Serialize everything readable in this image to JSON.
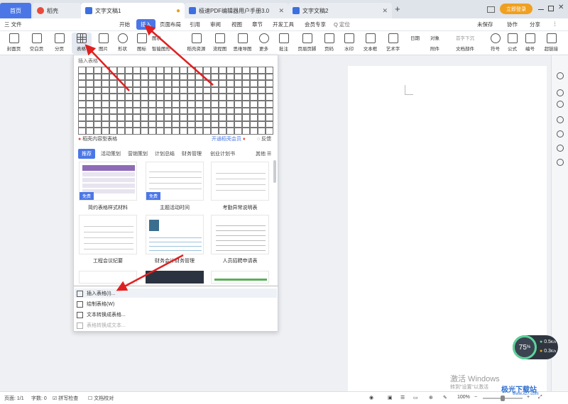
{
  "tabs": [
    {
      "label": "首页"
    },
    {
      "label": "稻壳"
    },
    {
      "label": "文字文稿1"
    },
    {
      "label": "极速PDF编辑器用户手册3.0"
    },
    {
      "label": "文字文稿2"
    }
  ],
  "titlebar": {
    "login": "立即登录"
  },
  "menubar": {
    "file": "三 文件",
    "items": [
      "开始",
      "插入",
      "页面布局",
      "引用",
      "审阅",
      "视图",
      "章节",
      "开发工具",
      "会员专享"
    ],
    "search": "Q 定位",
    "unsaved": "未保存",
    "collab": "协作",
    "share": "分享"
  },
  "ribbon": {
    "cover": "封面页",
    "blank": "空白页",
    "pagebreak": "分页",
    "table": "表格",
    "picture": "图片",
    "shape": "形状",
    "icon": "图标",
    "chart": "图表",
    "smartart": "智能图形",
    "dk_res": "稻壳资源",
    "flow": "流程图",
    "mind": "思维导图",
    "more": "更多",
    "comment": "批注",
    "header": "页眉页脚",
    "pagenum": "页码",
    "watermark": "水印",
    "textbox": "文本框",
    "wordart": "艺术字",
    "date": "日期",
    "object": "对象",
    "attach": "附件",
    "dropcap": "首字下沉",
    "docpart": "文档部件",
    "symbol": "符号",
    "formula": "公式",
    "numbering": "编号",
    "hyperlink": "超链接"
  },
  "dropdown": {
    "grid_title": "插入表格",
    "dk_tables": "稻壳内容型表格",
    "vip": "开通稻壳会员",
    "feedback": "反馈",
    "categories": [
      "推荐",
      "活动策划",
      "营销策划",
      "计划总结",
      "财务管理",
      "创业计划书",
      "其他"
    ],
    "free_badge": "免费",
    "templates": [
      "简约表格样式材料",
      "主题活动时间",
      "考勤异常说明表",
      "工程会议纪要",
      "财务会计财务管理",
      "人员招聘申请表"
    ],
    "menu_items": [
      {
        "label": "插入表格(I)..."
      },
      {
        "label": "绘制表格(W)"
      },
      {
        "label": "文本转换成表格..."
      },
      {
        "label": "表格转换成文本..."
      }
    ]
  },
  "status": {
    "page": "页面: 1/1",
    "words": "字数: 0",
    "spell": "拼写检查",
    "proof": "文档校对",
    "zoom": "100%"
  },
  "widget": {
    "pct": "75",
    "up": "0.5",
    "down": "0.3",
    "up_unit": "K/s",
    "down_unit": "K/s"
  },
  "watermark": {
    "line1": "激活 Windows",
    "line2": "转到\"设置\"以激活",
    "brand": "极光下载站",
    "brand_url": "www.xz7.com"
  }
}
